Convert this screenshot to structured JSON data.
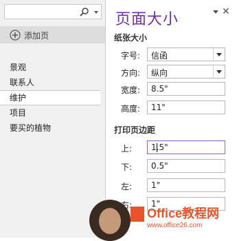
{
  "left": {
    "add_page_label": "添加页",
    "pages": [
      "景观",
      "联系人",
      "维护",
      "项目",
      "要买的植物"
    ],
    "selected_index": 2
  },
  "panel": {
    "title": "页面大小",
    "paper_section": "纸张大小",
    "size_label": "字号:",
    "size_value": "信函",
    "orientation_label": "方向:",
    "orientation_value": "纵向",
    "width_label": "宽度:",
    "width_value": "8.5\"",
    "height_label": "高度:",
    "height_value": "11\"",
    "margins_section": "打印页边距",
    "top_label": "上:",
    "top_value": "1.5\"",
    "bottom_label": "下:",
    "bottom_value": "0.5\"",
    "left_label": "左:",
    "left_value": "1\"",
    "right_label": "右:",
    "right_value": "1\""
  },
  "watermark": {
    "site": "Office教程网",
    "url": "www.office26.com"
  },
  "colors": {
    "title": "#7030a0",
    "accent": "#e8542a"
  }
}
